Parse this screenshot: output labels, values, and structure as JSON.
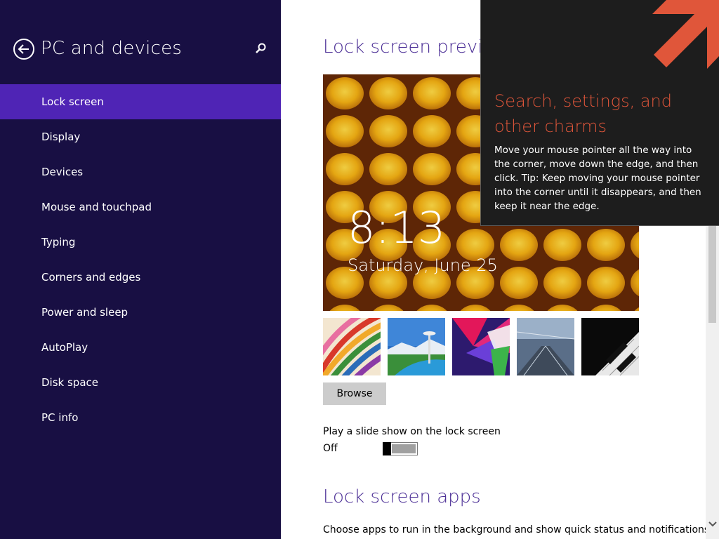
{
  "sidebar": {
    "title": "PC and devices",
    "items": [
      {
        "label": "Lock screen",
        "active": true
      },
      {
        "label": "Display"
      },
      {
        "label": "Devices"
      },
      {
        "label": "Mouse and touchpad"
      },
      {
        "label": "Typing"
      },
      {
        "label": "Corners and edges"
      },
      {
        "label": "Power and sleep"
      },
      {
        "label": "AutoPlay"
      },
      {
        "label": "Disk space"
      },
      {
        "label": "PC info"
      }
    ],
    "colors": {
      "background": "#180f43",
      "active": "#4f24b5"
    }
  },
  "main": {
    "preview_heading": "Lock screen preview",
    "preview_time": "8:13",
    "preview_date": "Saturday, June 25",
    "thumbnails": [
      "stripes-wallpaper",
      "space-needle-wallpaper",
      "abstract-shapes-wallpaper",
      "train-station-wallpaper",
      "piano-keys-wallpaper"
    ],
    "browse_label": "Browse",
    "slideshow_label": "Play a slide show on the lock screen",
    "slideshow_state": "Off",
    "slideshow_on": false,
    "apps_heading": "Lock screen apps",
    "apps_description": "Choose apps to run in the background and show quick status and notifications,",
    "heading_color": "#4a2d95"
  },
  "tip": {
    "title": "Search, settings, and other charms",
    "body": "Move your mouse pointer all the way into the corner, move down the edge, and then click. Tip: Keep moving your mouse pointer into the corner until it disappears, and then keep it near the edge.",
    "accent_color": "#e0563a"
  }
}
